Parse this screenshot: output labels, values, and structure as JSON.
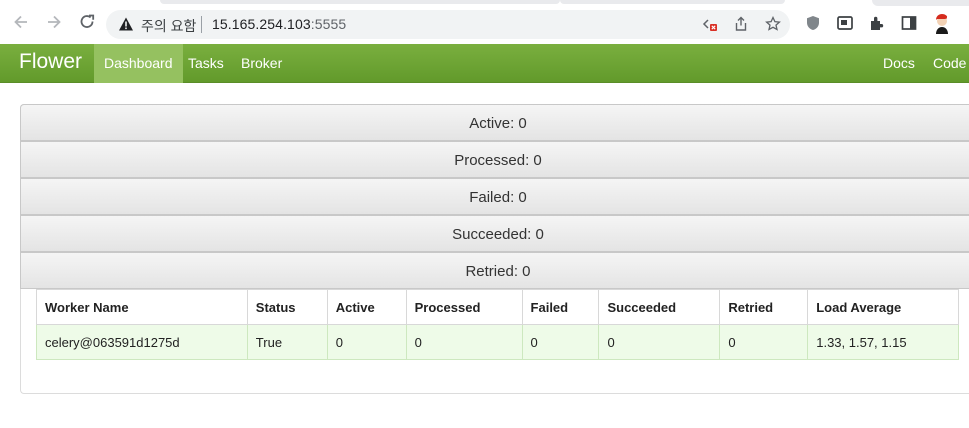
{
  "browser": {
    "security_label": "주의 요함",
    "url_host": "15.165.254.103",
    "url_port": ":5555"
  },
  "navbar": {
    "brand": "Flower",
    "items": [
      {
        "label": "Dashboard",
        "active": true
      },
      {
        "label": "Tasks",
        "active": false
      },
      {
        "label": "Broker",
        "active": false
      }
    ],
    "right_items": [
      {
        "label": "Docs"
      },
      {
        "label": "Code"
      }
    ]
  },
  "stats": [
    {
      "label": "Active: 0"
    },
    {
      "label": "Processed: 0"
    },
    {
      "label": "Failed: 0"
    },
    {
      "label": "Succeeded: 0"
    },
    {
      "label": "Retried: 0"
    }
  ],
  "workers_table": {
    "headers": [
      "Worker Name",
      "Status",
      "Active",
      "Processed",
      "Failed",
      "Succeeded",
      "Retried",
      "Load Average"
    ],
    "rows": [
      [
        "celery@063591d1275d",
        "True",
        "0",
        "0",
        "0",
        "0",
        "0",
        "1.33, 1.57, 1.15"
      ]
    ]
  },
  "colors": {
    "navbar": "#6fa636",
    "nav_active": "#95c160",
    "row_bg": "#eefbe8"
  }
}
